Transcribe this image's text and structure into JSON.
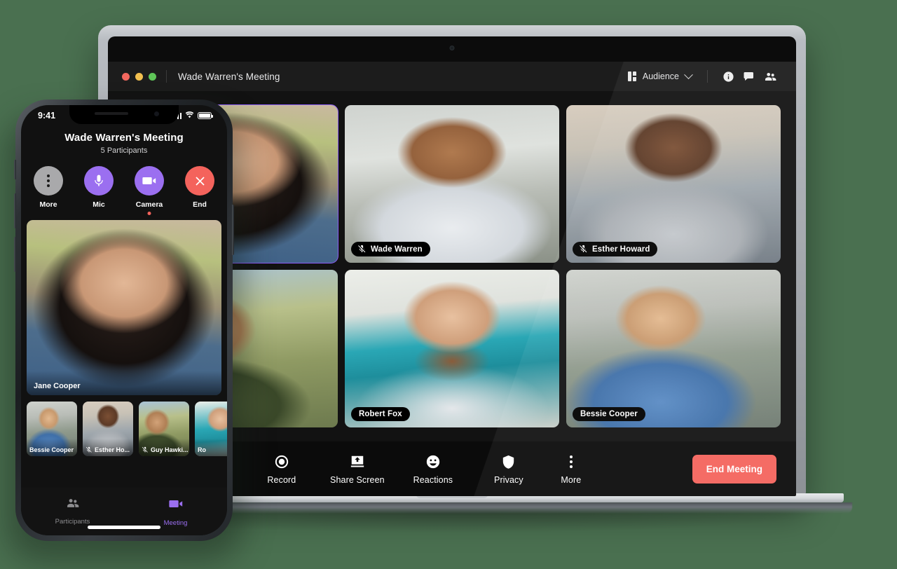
{
  "background_color": "#4a7050",
  "laptop": {
    "titlebar": {
      "window_title": "Wade Warren's Meeting",
      "layout_label": "Audience",
      "icons": [
        "layout-icon",
        "chevron-down-icon",
        "info-icon",
        "chat-icon",
        "participants-icon"
      ]
    },
    "grid": [
      {
        "name": "Jane Cooper",
        "muted": false,
        "active_speaker": true,
        "photo": "p-jane"
      },
      {
        "name": "Wade Warren",
        "muted": true,
        "active_speaker": false,
        "photo": "p-wade"
      },
      {
        "name": "Esther Howard",
        "muted": true,
        "active_speaker": false,
        "photo": "p-esther"
      },
      {
        "name": "Guy Hawkins",
        "muted": true,
        "active_speaker": false,
        "photo": "p-guy"
      },
      {
        "name": "Robert Fox",
        "muted": false,
        "active_speaker": false,
        "photo": "p-robert"
      },
      {
        "name": "Bessie Cooper",
        "muted": false,
        "active_speaker": false,
        "photo": "p-bessie"
      }
    ],
    "toolbar": {
      "collapse": "chevron-up-icon",
      "actions": [
        {
          "label": "Record",
          "icon": "record-icon"
        },
        {
          "label": "Share Screen",
          "icon": "share-screen-icon"
        },
        {
          "label": "Reactions",
          "icon": "reactions-icon"
        },
        {
          "label": "Privacy",
          "icon": "shield-icon"
        },
        {
          "label": "More",
          "icon": "more-dots-icon"
        }
      ],
      "end_meeting_label": "End Meeting",
      "end_meeting_color": "#f4635c"
    }
  },
  "phone": {
    "statusbar": {
      "time": "9:41",
      "signal": "signal-icon",
      "wifi": "wifi-icon",
      "battery": "battery-icon"
    },
    "header": {
      "title": "Wade Warren's Meeting",
      "subtitle": "5 Participants"
    },
    "controls": [
      {
        "label": "More",
        "icon": "more-dots-icon",
        "style": "gray",
        "indicator": false
      },
      {
        "label": "Mic",
        "icon": "mic-icon",
        "style": "purple",
        "indicator": false
      },
      {
        "label": "Camera",
        "icon": "camera-icon",
        "style": "purple",
        "indicator": true
      },
      {
        "label": "End",
        "icon": "close-icon",
        "style": "red",
        "indicator": false
      }
    ],
    "main_speaker": {
      "name": "Jane Cooper",
      "photo": "p-jane"
    },
    "thumbnails": [
      {
        "name": "Bessie Cooper",
        "muted": false,
        "photo": "p-bessie"
      },
      {
        "name": "Esther Ho...",
        "muted": true,
        "photo": "p-esther"
      },
      {
        "name": "Guy Hawki...",
        "muted": true,
        "photo": "p-guy"
      },
      {
        "name": "Ro",
        "muted": false,
        "photo": "p-ro"
      }
    ],
    "tabs": [
      {
        "label": "Participants",
        "icon": "participants-icon",
        "active": false
      },
      {
        "label": "Meeting",
        "icon": "camera-icon",
        "active": true
      }
    ],
    "accent_color": "#9b6ff0"
  }
}
